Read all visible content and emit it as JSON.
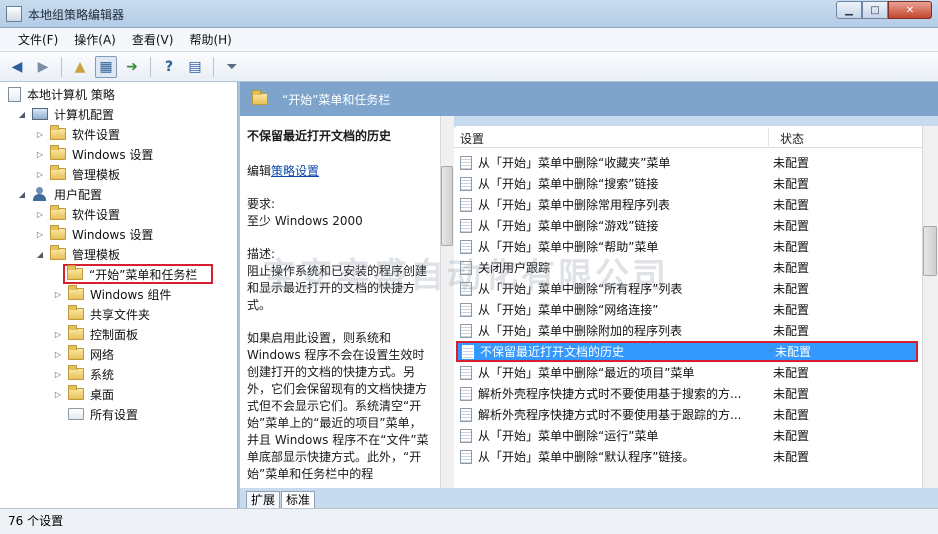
{
  "window": {
    "title": "本地组策略编辑器"
  },
  "menu": [
    "文件(F)",
    "操作(A)",
    "查看(V)",
    "帮助(H)"
  ],
  "toolbar": {
    "icons": [
      "back-arrow-icon",
      "forward-arrow-icon",
      "up-folder-icon",
      "show-hide-tree-icon",
      "export-list-icon",
      "help-icon",
      "properties-icon",
      "filter-icon"
    ]
  },
  "tree": {
    "root": "本地计算机 策略",
    "computer": "计算机配置",
    "computer_children": [
      "软件设置",
      "Windows 设置",
      "管理模板"
    ],
    "user": "用户配置",
    "user_children": [
      "软件设置",
      "Windows 设置",
      "管理模板"
    ],
    "admin_children": [
      "“开始”菜单和任务栏",
      "Windows 组件",
      "共享文件夹",
      "控制面板",
      "网络",
      "系统",
      "桌面",
      "所有设置"
    ]
  },
  "panel": {
    "header": "“开始”菜单和任务栏"
  },
  "description": {
    "title": "不保留最近打开文档的历史",
    "edit_prefix": "编辑",
    "edit_link": "策略设置",
    "req_label": "要求:",
    "req_value": "至少 Windows 2000",
    "desc_label": "描述:",
    "desc_text": "阻止操作系统和已安装的程序创建和显示最近打开的文档的快捷方式。",
    "desc_text2": "如果启用此设置，则系统和 Windows 程序不会在设置生效时创建打开的文档的快捷方式。另外，它们会保留现有的文档快捷方式但不会显示它们。系统清空“开始”菜单上的“最近的项目”菜单，并且 Windows 程序不在“文件”菜单底部显示快捷方式。此外，“开始”菜单和任务栏中的程"
  },
  "list": {
    "col_setting": "设置",
    "col_state": "状态",
    "rows": [
      {
        "name": "从「开始」菜单中删除“收藏夹”菜单",
        "state": "未配置"
      },
      {
        "name": "从「开始」菜单中删除“搜索”链接",
        "state": "未配置"
      },
      {
        "name": "从「开始」菜单中删除常用程序列表",
        "state": "未配置"
      },
      {
        "name": "从「开始」菜单中删除“游戏”链接",
        "state": "未配置"
      },
      {
        "name": "从「开始」菜单中删除“帮助”菜单",
        "state": "未配置"
      },
      {
        "name": "关闭用户跟踪",
        "state": "未配置"
      },
      {
        "name": "从「开始」菜单中删除“所有程序”列表",
        "state": "未配置"
      },
      {
        "name": "从「开始」菜单中删除“网络连接”",
        "state": "未配置"
      },
      {
        "name": "从「开始」菜单中删除附加的程序列表",
        "state": "未配置"
      },
      {
        "name": "不保留最近打开文档的历史",
        "state": "未配置"
      },
      {
        "name": "从「开始」菜单中删除“最近的项目”菜单",
        "state": "未配置"
      },
      {
        "name": "解析外壳程序快捷方式时不要使用基于搜索的方...",
        "state": "未配置"
      },
      {
        "name": "解析外壳程序快捷方式时不要使用基于跟踪的方...",
        "state": "未配置"
      },
      {
        "name": "从「开始」菜单中删除“运行”菜单",
        "state": "未配置"
      },
      {
        "name": "从「开始」菜单中删除“默认程序”链接。",
        "state": "未配置"
      }
    ]
  },
  "tabs": [
    "扩展",
    "标准"
  ],
  "status": "76 个设置",
  "watermark": "宝安实盛自动化有限公司"
}
